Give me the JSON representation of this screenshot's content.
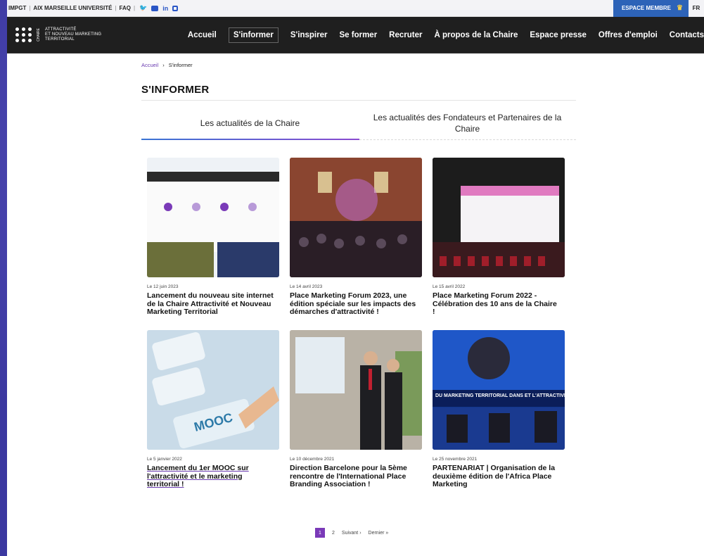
{
  "topbar": {
    "links": [
      "IMPGT",
      "AIX MARSEILLE UNIVERSITÉ",
      "FAQ"
    ],
    "member_label": "ESPACE MEMBRE",
    "lang": "FR"
  },
  "logo": {
    "vertical": "CHAIRE",
    "line1": "ATTRACTIVITÉ",
    "line2": "ET NOUVEAU MARKETING",
    "line3": "TERRITORIAL"
  },
  "nav": [
    "Accueil",
    "S'informer",
    "S'inspirer",
    "Se former",
    "Recruter",
    "À propos de la Chaire",
    "Espace presse",
    "Offres d'emploi",
    "Contacts"
  ],
  "breadcrumb": {
    "home": "Accueil",
    "sep": "›",
    "current": "S'informer"
  },
  "page_title": "S'INFORMER",
  "tabs": [
    "Les actualités de la Chaire",
    "Les actualités des Fondateurs et Partenaires de la Chaire"
  ],
  "cards": [
    {
      "date": "Le 12 juin 2023",
      "title": "Lancement du nouveau site internet de la Chaire Attractivité et Nouveau Marketing Territorial"
    },
    {
      "date": "Le 14 avril 2023",
      "title": "Place Marketing Forum 2023, une édition spéciale sur les impacts des démarches d'attractivité !"
    },
    {
      "date": "Le 15 avril 2022",
      "title": "Place Marketing Forum 2022 - Célébration des 10 ans de la Chaire !"
    },
    {
      "date": "Le 5 janvier 2022",
      "title": "Lancement du 1er MOOC sur l'attractivité et le marketing territorial !"
    },
    {
      "date": "Le 10 décembre 2021",
      "title": "Direction Barcelone pour la 5ème rencontre de l'International Place Branding Association !"
    },
    {
      "date": "Le 25 novembre 2021",
      "title": "PARTENARIAT | Organisation de la deuxième édition de l'Africa Place Marketing"
    }
  ],
  "thumb_text": {
    "mooc": "MOOC",
    "banner": "DU MARKETING TERRITORIAL DANS ET L'ATTRACTIVITÉ DES TERRITOIRES"
  },
  "pager": {
    "current": "1",
    "next_page": "2",
    "next": "Suivant ›",
    "last": "Dernier »"
  }
}
